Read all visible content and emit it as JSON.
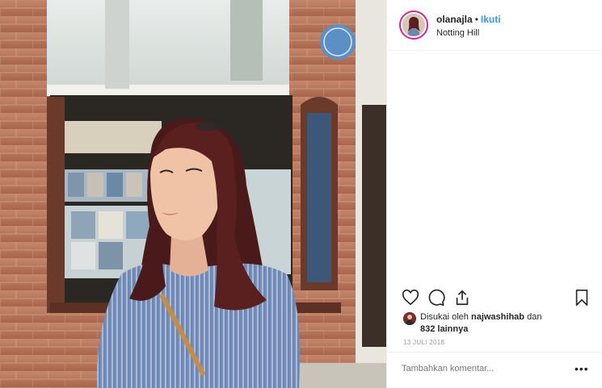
{
  "post": {
    "username": "olanajla",
    "separator": "•",
    "follow_label": "Ikuti",
    "location": "Notting Hill"
  },
  "likes": {
    "prefix": "Disukai oleh",
    "liker": "najwashihab",
    "connector": "dan",
    "count_text": "832 lainnya"
  },
  "date": "13 JULI 2018",
  "comment": {
    "placeholder": "Tambahkan komentar...",
    "more_label": "•••"
  },
  "icons": {
    "like": "heart-icon",
    "comment": "comment-icon",
    "share": "share-icon",
    "save": "bookmark-icon"
  },
  "colors": {
    "accent": "#3897f0",
    "text": "#262626",
    "muted": "#999999",
    "avatar_ring": "#d6249f"
  }
}
